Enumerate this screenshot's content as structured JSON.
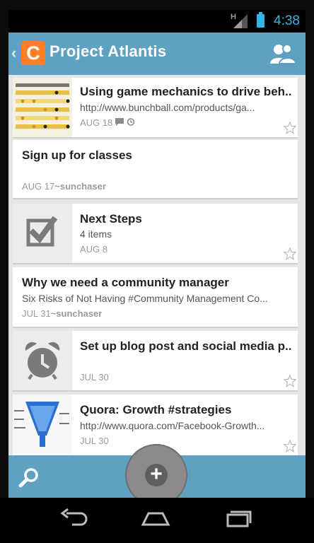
{
  "status_bar": {
    "network": "H",
    "time": "4:38"
  },
  "action_bar": {
    "logo_letter": "C",
    "title": "Project Atlantis",
    "accent_color": "#5fa1c0",
    "logo_color": "#ff7f26"
  },
  "cards": [
    {
      "title": "Using game mechanics to drive beh...",
      "subtitle": "http://www.bunchball.com/products/ga...",
      "date": "AUG 18",
      "author": "",
      "thumb": "spreadsheet-image"
    },
    {
      "title": "Sign up for classes",
      "subtitle": "",
      "date": "AUG 17",
      "author": "~sunchaser",
      "thumb": ""
    },
    {
      "title": "Next Steps",
      "subtitle": "4 items",
      "date": "AUG 8",
      "author": "",
      "thumb": "checkbox-icon"
    },
    {
      "title": "Why we need a community manager",
      "subtitle": "Six Risks of Not Having #Community Management Co...",
      "date": "JUL 31",
      "author": "~sunchaser",
      "thumb": ""
    },
    {
      "title": "Set up blog post and social media p...",
      "subtitle": "",
      "date": "JUL 30",
      "author": "",
      "thumb": "alarm-clock-icon"
    },
    {
      "title": "Quora: Growth #strategies",
      "subtitle": "http://www.quora.com/Facebook-Growth...",
      "date": "JUL 30",
      "author": "",
      "thumb": "funnel-image"
    }
  ],
  "bottom_bar": {
    "add_label": "+"
  }
}
